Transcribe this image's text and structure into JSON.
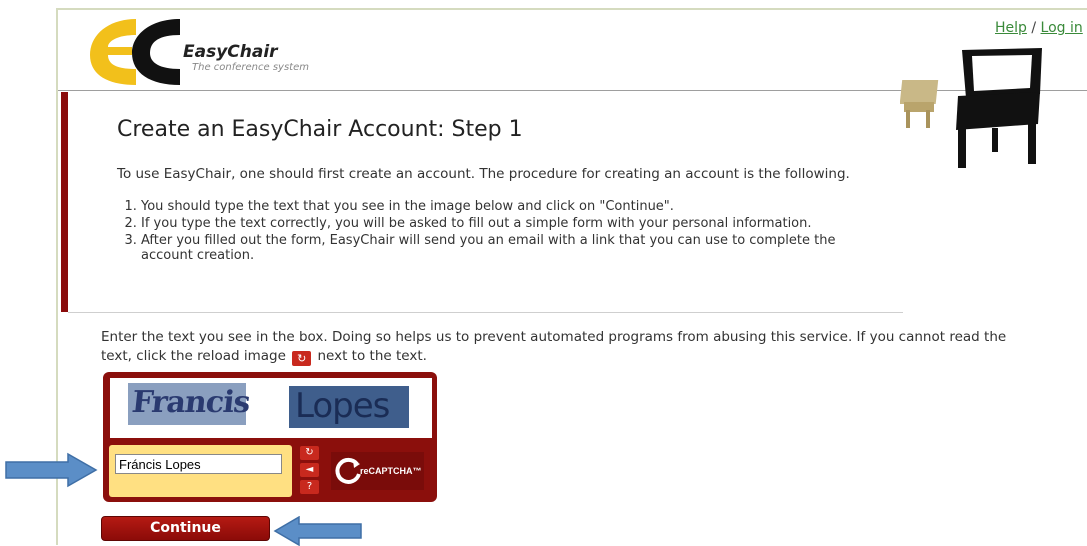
{
  "header": {
    "logo_text": "EasyChair",
    "logo_subtitle": "The conference system",
    "help_link": "Help",
    "separator": "/",
    "login_link": "Log in"
  },
  "page": {
    "title": "Create an EasyChair Account: Step 1",
    "intro": "To use EasyChair, one should first create an account. The procedure for creating an account is the following.",
    "steps": [
      "You should type the text that you see in the image below and click on \"Continue\".",
      "If you type the text correctly, you will be asked to fill out a simple form with your personal information.",
      "After you filled out the form, EasyChair will send you an email with a link that you can use to complete the account creation."
    ]
  },
  "captcha": {
    "instructions_part1": "Enter the text you see in the box. Doing so helps us to prevent automated programs from abusing this service. If you cannot read the text, click the reload image",
    "instructions_part2": "next to the text.",
    "word1": "Francis",
    "word2": "Lopes",
    "input_value": "Fráncis Lopes",
    "brand": "reCAPTCHA™",
    "icons": [
      "reload-icon",
      "audio-icon",
      "help-icon"
    ]
  },
  "actions": {
    "continue_label": "Continue"
  },
  "colors": {
    "accent": "#8a0b0b",
    "captcha_bg": "#8b0f0c",
    "input_area": "#ffe082",
    "link": "#3a8a3a",
    "arrow": "#5b8ec7"
  }
}
